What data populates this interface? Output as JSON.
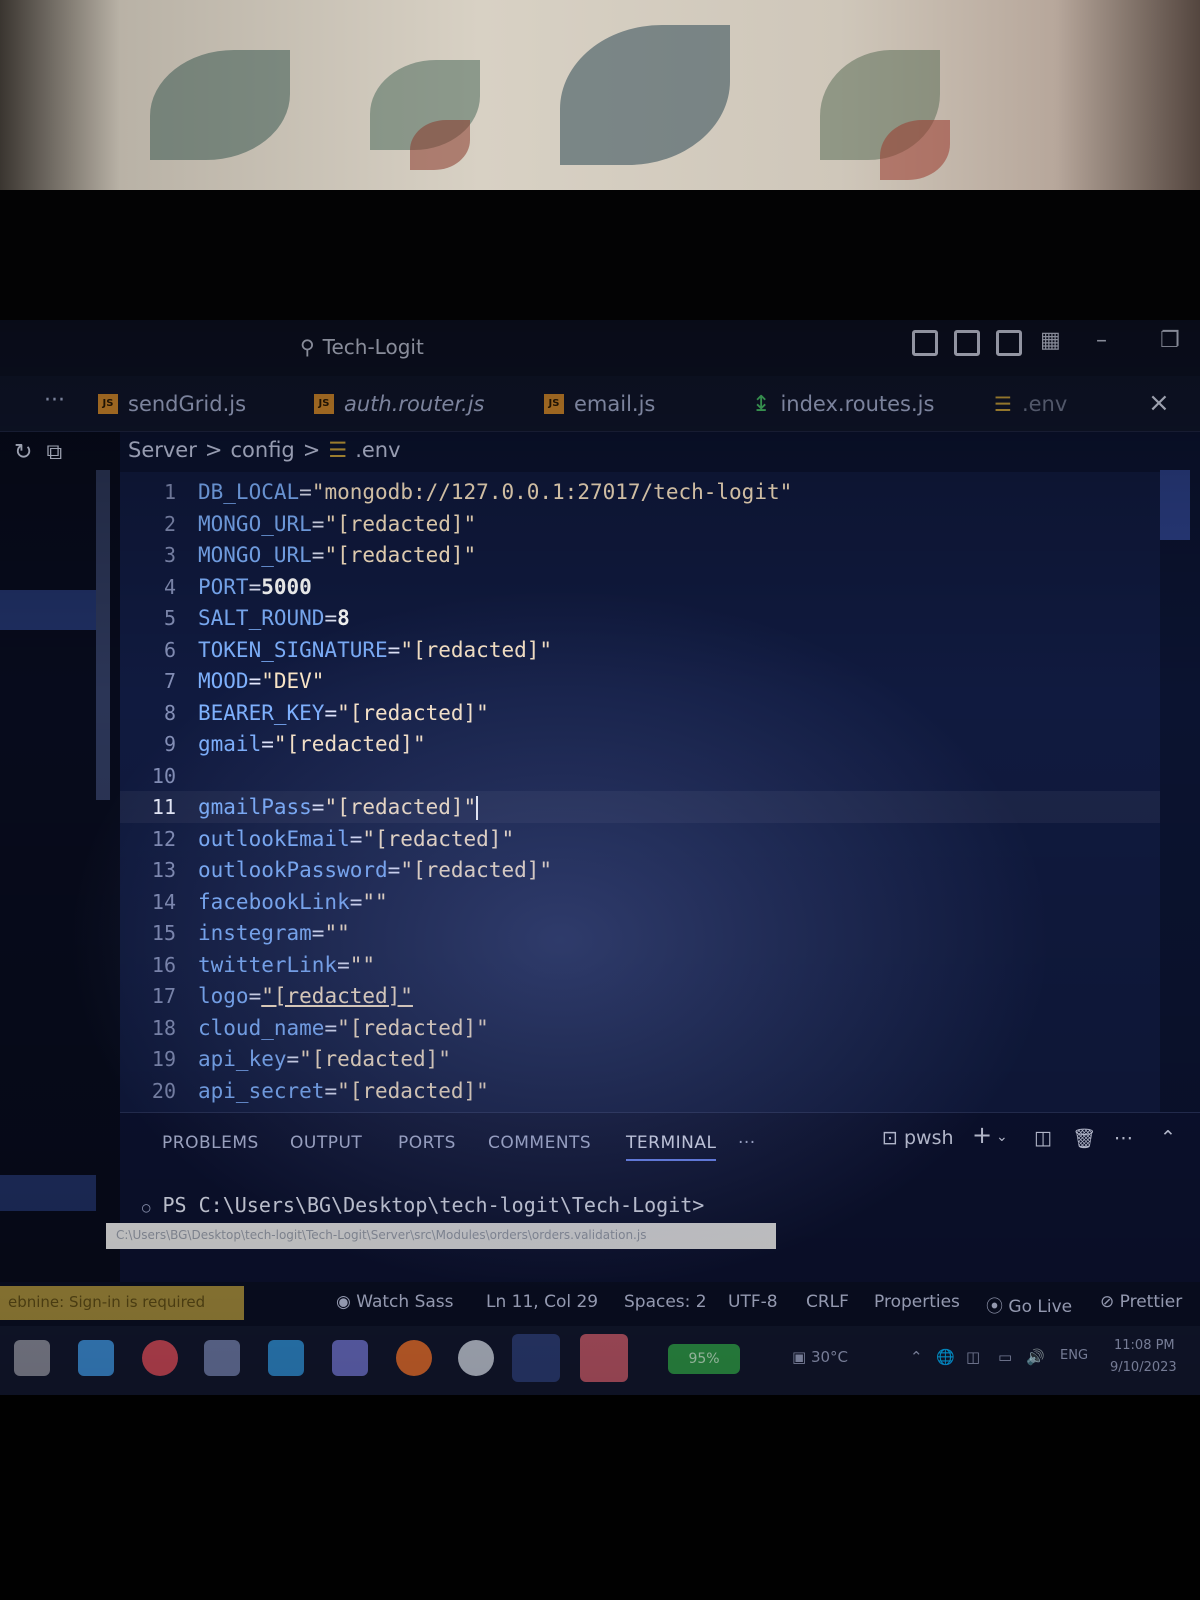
{
  "window": {
    "search_label": "Tech-Logit",
    "more_label": "···",
    "close_label": "×"
  },
  "tabs": [
    {
      "label": "sendGrid.js",
      "icon": "js-file-icon"
    },
    {
      "label": "auth.router.js",
      "icon": "js-file-icon"
    },
    {
      "label": "email.js",
      "icon": "js-file-icon"
    },
    {
      "label": "index.routes.js",
      "icon": "routes-file-icon"
    },
    {
      "label": ".env",
      "icon": "env-file-icon"
    }
  ],
  "breadcrumb": {
    "parts": [
      "Server",
      "config",
      ".env"
    ],
    "sep": ">"
  },
  "editor": {
    "lines": [
      {
        "num": "1",
        "key": "DB_LOCAL",
        "value": "\"mongodb://127.0.0.1:27017/tech-logit\""
      },
      {
        "num": "2",
        "key": "MONGO_URL",
        "value": "\"[redacted]\""
      },
      {
        "num": "3",
        "key": "MONGO_URL",
        "value": "\"[redacted]\""
      },
      {
        "num": "4",
        "key": "PORT",
        "value": "5000"
      },
      {
        "num": "5",
        "key": "SALT_ROUND",
        "value": "8"
      },
      {
        "num": "6",
        "key": "TOKEN_SIGNATURE",
        "value": "\"[redacted]\""
      },
      {
        "num": "7",
        "key": "MOOD",
        "value": "\"DEV\""
      },
      {
        "num": "8",
        "key": "BEARER_KEY",
        "value": "\"[redacted]\""
      },
      {
        "num": "9",
        "key": "gmail",
        "value": "\"[redacted]\""
      },
      {
        "num": "10",
        "key": "",
        "value": ""
      },
      {
        "num": "11",
        "key": "gmailPass",
        "value": "\"[redacted]\""
      },
      {
        "num": "12",
        "key": "outlookEmail",
        "value": "\"[redacted]\""
      },
      {
        "num": "13",
        "key": "outlookPassword",
        "value": "\"[redacted]\""
      },
      {
        "num": "14",
        "key": "facebookLink",
        "value": "\"\""
      },
      {
        "num": "15",
        "key": "instegram",
        "value": "\"\""
      },
      {
        "num": "16",
        "key": "twitterLink",
        "value": "\"\""
      },
      {
        "num": "17",
        "key": "logo",
        "value": "\"[redacted]\""
      },
      {
        "num": "18",
        "key": "cloud_name",
        "value": "\"[redacted]\""
      },
      {
        "num": "19",
        "key": "api_key",
        "value": "\"[redacted]\""
      },
      {
        "num": "20",
        "key": "api_secret",
        "value": "\"[redacted]\""
      }
    ],
    "current_line": "11"
  },
  "panel": {
    "tabs": [
      "PROBLEMS",
      "OUTPUT",
      "PORTS",
      "COMMENTS",
      "TERMINAL"
    ],
    "active_tab": "TERMINAL",
    "more_label": "···",
    "shell_label": "pwsh",
    "terminal_prompt": "PS C:\\Users\\BG\\Desktop\\tech-logit\\Tech-Logit>",
    "tooltip": "C:\\Users\\BG\\Desktop\\tech-logit\\Tech-Logit\\Server\\src\\Modules\\orders\\orders.validation.js"
  },
  "statusbar": {
    "warning": "ebnine: Sign-in is required",
    "watch_sass": "Watch Sass",
    "position": "Ln 11, Col 29",
    "spaces": "Spaces: 2",
    "encoding": "UTF-8",
    "eol": "CRLF",
    "language": "Properties",
    "go_live": "Go Live",
    "prettier": "Prettier"
  },
  "taskbar": {
    "battery": "95%",
    "temperature": "30°C",
    "language": "ENG",
    "time": "11:08 PM",
    "date": "9/10/2023"
  }
}
